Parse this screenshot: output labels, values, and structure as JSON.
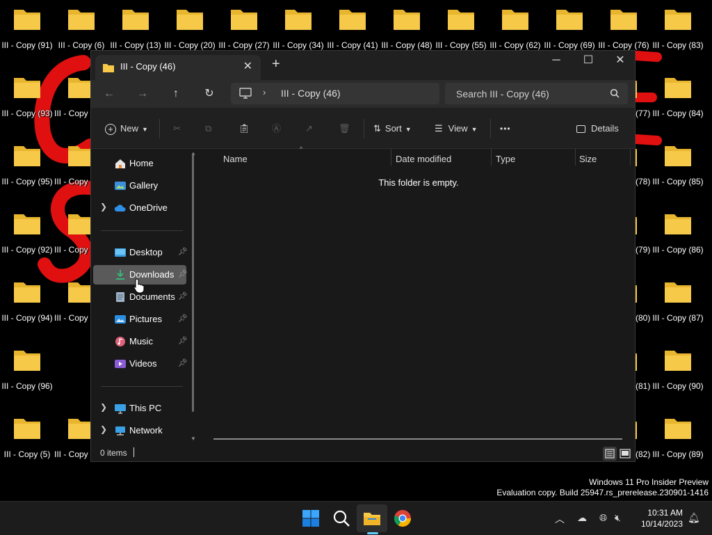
{
  "desktop": {
    "top_row": [
      "III - Copy (91)",
      "III - Copy (6)",
      "III - Copy (13)",
      "III - Copy (20)",
      "III - Copy (27)",
      "III - Copy (34)",
      "III - Copy (41)",
      "III - Copy (48)",
      "III - Copy (55)",
      "III - Copy (62)",
      "III - Copy (69)",
      "III - Copy (76)",
      "III - Copy (83)"
    ],
    "left_col": [
      "III - Copy (93)",
      "III - Copy (95)",
      "III - Copy (92)",
      "III - Copy (94)",
      "III - Copy (96)",
      "III - Copy (5)"
    ],
    "second_col": [
      "III - Copy",
      "III - Copy",
      "III - Copy",
      "III - Copy",
      "III - Copy"
    ],
    "right_partial": [
      "(77)",
      "(78)",
      "(79)",
      "(80)",
      "(81)",
      "(82)"
    ],
    "right_col": [
      "III - Copy (84)",
      "III - Copy (85)",
      "III - Copy (86)",
      "III - Copy (87)",
      "III - Copy (90)",
      "III - Copy (89)"
    ]
  },
  "window": {
    "tab_title": "III - Copy (46)",
    "address_path": "III - Copy (46)",
    "search_placeholder": "Search III - Copy (46)",
    "toolbar": {
      "new_label": "New",
      "sort_label": "Sort",
      "view_label": "View",
      "more_label": "•••",
      "details_label": "Details"
    },
    "sidebar": {
      "items": [
        {
          "label": "Home"
        },
        {
          "label": "Gallery"
        },
        {
          "label": "OneDrive"
        },
        {
          "label": "Desktop"
        },
        {
          "label": "Downloads"
        },
        {
          "label": "Documents"
        },
        {
          "label": "Pictures"
        },
        {
          "label": "Music"
        },
        {
          "label": "Videos"
        },
        {
          "label": "This PC"
        },
        {
          "label": "Network"
        }
      ]
    },
    "columns": {
      "name": "Name",
      "date": "Date modified",
      "type": "Type",
      "size": "Size"
    },
    "empty_text": "This folder is empty.",
    "status_count": "0 items"
  },
  "watermark": {
    "line1": "Windows 11 Pro Insider Preview",
    "line2": "Evaluation copy. Build 25947.rs_prerelease.230901-1416"
  },
  "taskbar": {
    "time": "10:31 AM",
    "date": "10/14/2023"
  },
  "colors": {
    "accent": "#60cdff",
    "folder": "#f7c948",
    "wallpaper_red": "#e01010"
  }
}
